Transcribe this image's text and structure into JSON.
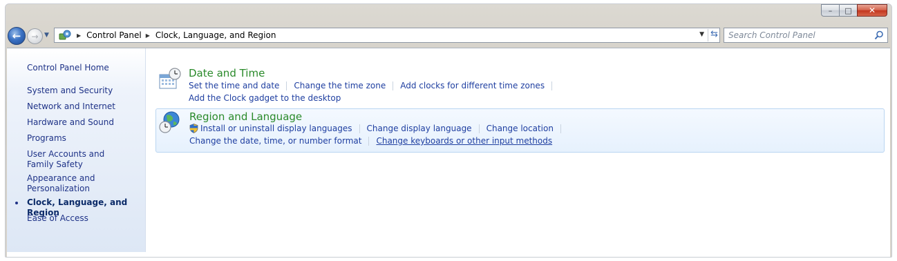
{
  "window": {
    "caption": {
      "minimize": "–",
      "maximize": "□",
      "close": "✕"
    }
  },
  "navbar": {
    "back_glyph": "←",
    "forward_glyph": "→",
    "recent_glyph": "▼",
    "breadcrumb_sep": "▶",
    "breadcrumb": [
      "Control Panel",
      "Clock, Language, and Region"
    ],
    "dropdown_glyph": "▼",
    "refresh_glyph": "⇆",
    "search_placeholder": "Search Control Panel"
  },
  "sidebar": {
    "items": [
      {
        "label": "Control Panel Home"
      },
      {
        "label": "System and Security"
      },
      {
        "label": "Network and Internet"
      },
      {
        "label": "Hardware and Sound"
      },
      {
        "label": "Programs"
      },
      {
        "label": "User Accounts and Family Safety"
      },
      {
        "label": "Appearance and Personalization"
      },
      {
        "label": "Clock, Language, and Region",
        "active": true
      },
      {
        "label": "Ease of Access"
      }
    ]
  },
  "categories": {
    "date_time": {
      "title": "Date and Time",
      "links": [
        "Set the time and date",
        "Change the time zone",
        "Add clocks for different time zones",
        "Add the Clock gadget to the desktop"
      ]
    },
    "region_language": {
      "title": "Region and Language",
      "links": [
        "Install or uninstall display languages",
        "Change display language",
        "Change location",
        "Change the date, time, or number format",
        "Change keyboards or other input methods"
      ]
    }
  },
  "colors": {
    "link": "#1e3ea0",
    "category_title": "#2a8a2a",
    "sidebar_text": "#1e3287"
  }
}
